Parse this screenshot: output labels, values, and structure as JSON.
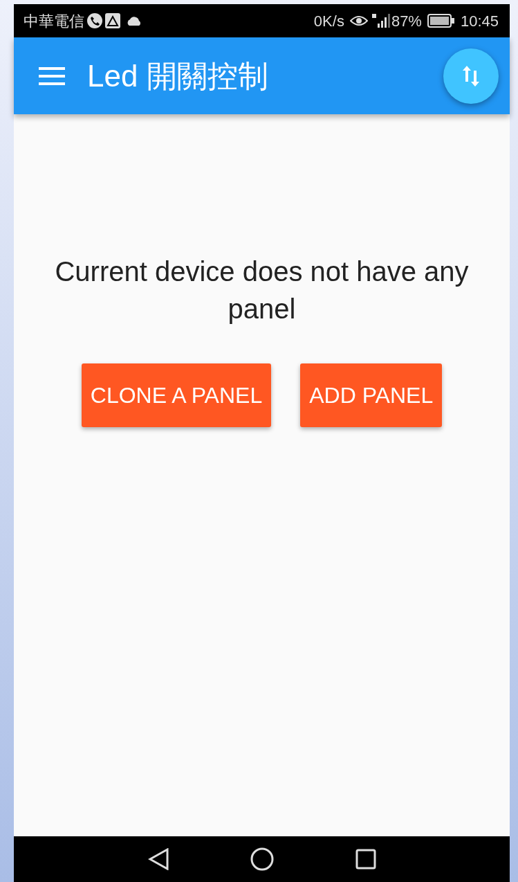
{
  "status_bar": {
    "carrier": "中華電信",
    "speed": "0K/s",
    "battery": "87%",
    "time": "10:45"
  },
  "app_bar": {
    "title": "Led 開關控制"
  },
  "empty_state": {
    "message": "Current device does not have any panel"
  },
  "buttons": [
    {
      "label": "CLONE A PANEL"
    },
    {
      "label": "ADD PANEL"
    }
  ]
}
